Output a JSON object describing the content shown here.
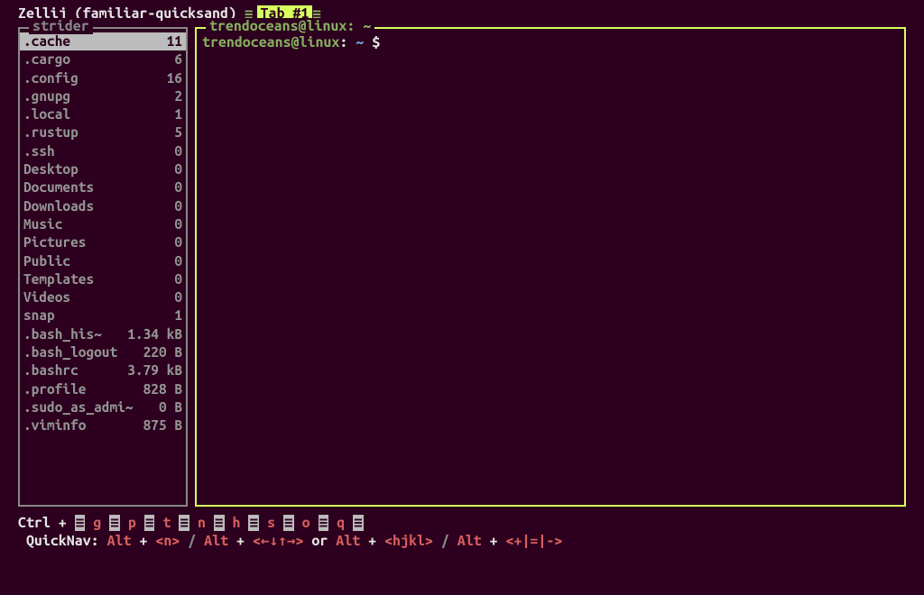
{
  "header": {
    "app_name": "Zellij",
    "session_name": "(familiar-quicksand)",
    "tab_label": "Tab #1"
  },
  "strider": {
    "title": "strider",
    "entries": [
      {
        "name": ".cache",
        "value": "11",
        "highlighted": true
      },
      {
        "name": ".cargo",
        "value": "6"
      },
      {
        "name": ".config",
        "value": "16"
      },
      {
        "name": ".gnupg",
        "value": "2"
      },
      {
        "name": ".local",
        "value": "1"
      },
      {
        "name": ".rustup",
        "value": "5"
      },
      {
        "name": ".ssh",
        "value": "0"
      },
      {
        "name": "Desktop",
        "value": "0"
      },
      {
        "name": "Documents",
        "value": "0"
      },
      {
        "name": "Downloads",
        "value": "0"
      },
      {
        "name": "Music",
        "value": "0"
      },
      {
        "name": "Pictures",
        "value": "0"
      },
      {
        "name": "Public",
        "value": "0"
      },
      {
        "name": "Templates",
        "value": "0"
      },
      {
        "name": "Videos",
        "value": "0"
      },
      {
        "name": "snap",
        "value": "1"
      },
      {
        "name": ".bash_his~",
        "value": "1.34 kB"
      },
      {
        "name": ".bash_logout",
        "value": "220 B"
      },
      {
        "name": ".bashrc",
        "value": "3.79 kB"
      },
      {
        "name": ".profile",
        "value": "828 B"
      },
      {
        "name": ".sudo_as_admi~",
        "value": "0 B"
      },
      {
        "name": ".viminfo",
        "value": "875 B"
      }
    ]
  },
  "terminal": {
    "title": "trendoceans@linux: ~",
    "prompt_user": "trendoceans@linux",
    "prompt_sep": ":",
    "prompt_path": "~",
    "prompt_dollar": "$"
  },
  "bottom": {
    "ctrl_label": "Ctrl +",
    "keys": [
      {
        "key": "g"
      },
      {
        "key": "p"
      },
      {
        "key": "t"
      },
      {
        "key": "n"
      },
      {
        "key": "h"
      },
      {
        "key": "s"
      },
      {
        "key": "o"
      },
      {
        "key": "q"
      }
    ],
    "quicknav_label": "QuickNav:",
    "alt": "Alt",
    "plus": "+",
    "n_key": "<n>",
    "or": "or",
    "hjkl": "<hjkl>",
    "divider": "/",
    "plusminuspipe": "<+|=|->"
  }
}
